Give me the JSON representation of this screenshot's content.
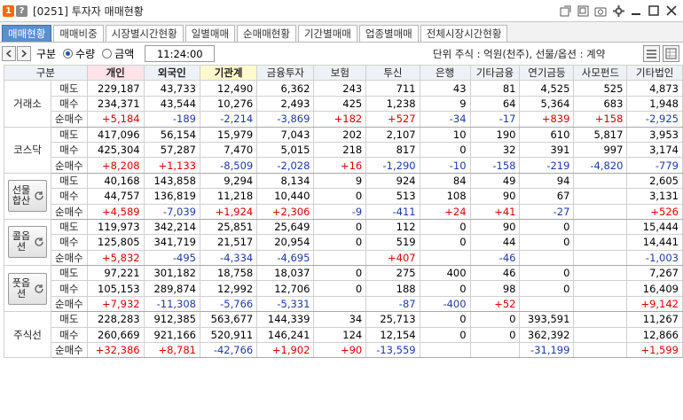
{
  "window": {
    "title": "[0251] 투자자 매매현황",
    "badge1": "1",
    "badge2": "?"
  },
  "tabs": [
    "매매현황",
    "매매비중",
    "시장별시간현황",
    "일별매매",
    "순매매현황",
    "기간별매매",
    "업종별매매",
    "전체시장시간현황"
  ],
  "controls": {
    "division_label": "구분",
    "radio_qty": "수량",
    "radio_amount": "금액",
    "time": "11:24:00",
    "unit": "단위 주식 : 억원(천주), 선물/옵션 : 계약"
  },
  "table": {
    "headers": [
      "구분",
      "개인",
      "외국인",
      "기관계",
      "금융투자",
      "보험",
      "투신",
      "은행",
      "기타금융",
      "연기금등",
      "사모펀드",
      "기타법인"
    ],
    "row_labels": [
      "매도",
      "매수",
      "순매수"
    ],
    "groups": [
      {
        "name": "거래소",
        "rows": [
          [
            "229,187",
            "43,733",
            "12,490",
            "6,362",
            "243",
            "711",
            "43",
            "81",
            "4,525",
            "525",
            "4,873"
          ],
          [
            "234,371",
            "43,544",
            "10,276",
            "2,493",
            "425",
            "1,238",
            "9",
            "64",
            "5,364",
            "683",
            "1,948"
          ],
          [
            "+5,184",
            "-189",
            "-2,214",
            "-3,869",
            "+182",
            "+527",
            "-34",
            "-17",
            "+839",
            "+158",
            "-2,925"
          ]
        ]
      },
      {
        "name": "코스닥",
        "rows": [
          [
            "417,096",
            "56,154",
            "15,979",
            "7,043",
            "202",
            "2,107",
            "10",
            "190",
            "610",
            "5,817",
            "3,953"
          ],
          [
            "425,304",
            "57,287",
            "7,470",
            "5,015",
            "218",
            "817",
            "0",
            "32",
            "391",
            "997",
            "3,174"
          ],
          [
            "+8,208",
            "+1,133",
            "-8,509",
            "-2,028",
            "+16",
            "-1,290",
            "-10",
            "-158",
            "-219",
            "-4,820",
            "-779"
          ]
        ]
      },
      {
        "name": "선물합산",
        "rows": [
          [
            "40,168",
            "143,858",
            "9,294",
            "8,134",
            "9",
            "924",
            "84",
            "49",
            "94",
            "",
            "2,605"
          ],
          [
            "44,757",
            "136,819",
            "11,218",
            "10,440",
            "0",
            "513",
            "108",
            "90",
            "67",
            "",
            "3,131"
          ],
          [
            "+4,589",
            "-7,039",
            "+1,924",
            "+2,306",
            "-9",
            "-411",
            "+24",
            "+41",
            "-27",
            "",
            "+526"
          ]
        ]
      },
      {
        "name": "콜옵션",
        "rows": [
          [
            "119,973",
            "342,214",
            "25,851",
            "25,649",
            "0",
            "112",
            "0",
            "90",
            "0",
            "",
            "15,444"
          ],
          [
            "125,805",
            "341,719",
            "21,517",
            "20,954",
            "0",
            "519",
            "0",
            "44",
            "0",
            "",
            "14,441"
          ],
          [
            "+5,832",
            "-495",
            "-4,334",
            "-4,695",
            "",
            "+407",
            "",
            "-46",
            "",
            "",
            "-1,003"
          ]
        ]
      },
      {
        "name": "풋옵션",
        "rows": [
          [
            "97,221",
            "301,182",
            "18,758",
            "18,037",
            "0",
            "275",
            "400",
            "46",
            "0",
            "",
            "7,267"
          ],
          [
            "105,153",
            "289,874",
            "12,992",
            "12,706",
            "0",
            "188",
            "0",
            "98",
            "0",
            "",
            "16,409"
          ],
          [
            "+7,932",
            "-11,308",
            "-5,766",
            "-5,331",
            "",
            "-87",
            "-400",
            "+52",
            "",
            "",
            "+9,142"
          ]
        ]
      },
      {
        "name": "주식선",
        "rows": [
          [
            "228,283",
            "912,385",
            "563,677",
            "144,339",
            "34",
            "25,713",
            "0",
            "0",
            "393,591",
            "",
            "11,267"
          ],
          [
            "260,669",
            "921,166",
            "520,911",
            "146,241",
            "124",
            "12,154",
            "0",
            "0",
            "362,392",
            "",
            "12,866"
          ],
          [
            "+32,386",
            "+8,781",
            "-42,766",
            "+1,902",
            "+90",
            "-13,559",
            "",
            "",
            "-31,199",
            "",
            "+1,599"
          ]
        ]
      }
    ]
  },
  "colors": {
    "tab_active": "#5a8fd0",
    "positive": "#e00000",
    "negative": "#1e3aa8",
    "header_highlight": "#ffe3e8"
  }
}
